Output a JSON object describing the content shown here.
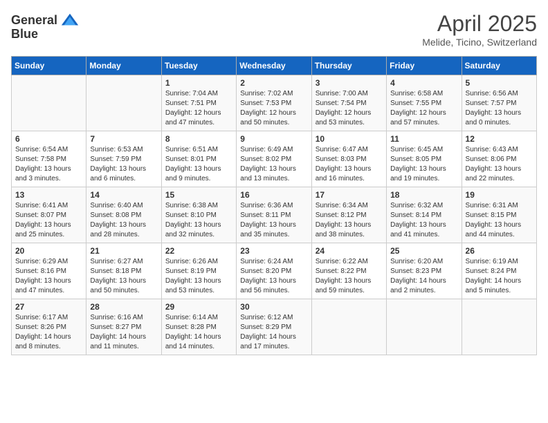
{
  "header": {
    "logo_general": "General",
    "logo_blue": "Blue",
    "month": "April 2025",
    "location": "Melide, Ticino, Switzerland"
  },
  "weekdays": [
    "Sunday",
    "Monday",
    "Tuesday",
    "Wednesday",
    "Thursday",
    "Friday",
    "Saturday"
  ],
  "weeks": [
    [
      {
        "day": "",
        "info": ""
      },
      {
        "day": "",
        "info": ""
      },
      {
        "day": "1",
        "info": "Sunrise: 7:04 AM\nSunset: 7:51 PM\nDaylight: 12 hours and 47 minutes."
      },
      {
        "day": "2",
        "info": "Sunrise: 7:02 AM\nSunset: 7:53 PM\nDaylight: 12 hours and 50 minutes."
      },
      {
        "day": "3",
        "info": "Sunrise: 7:00 AM\nSunset: 7:54 PM\nDaylight: 12 hours and 53 minutes."
      },
      {
        "day": "4",
        "info": "Sunrise: 6:58 AM\nSunset: 7:55 PM\nDaylight: 12 hours and 57 minutes."
      },
      {
        "day": "5",
        "info": "Sunrise: 6:56 AM\nSunset: 7:57 PM\nDaylight: 13 hours and 0 minutes."
      }
    ],
    [
      {
        "day": "6",
        "info": "Sunrise: 6:54 AM\nSunset: 7:58 PM\nDaylight: 13 hours and 3 minutes."
      },
      {
        "day": "7",
        "info": "Sunrise: 6:53 AM\nSunset: 7:59 PM\nDaylight: 13 hours and 6 minutes."
      },
      {
        "day": "8",
        "info": "Sunrise: 6:51 AM\nSunset: 8:01 PM\nDaylight: 13 hours and 9 minutes."
      },
      {
        "day": "9",
        "info": "Sunrise: 6:49 AM\nSunset: 8:02 PM\nDaylight: 13 hours and 13 minutes."
      },
      {
        "day": "10",
        "info": "Sunrise: 6:47 AM\nSunset: 8:03 PM\nDaylight: 13 hours and 16 minutes."
      },
      {
        "day": "11",
        "info": "Sunrise: 6:45 AM\nSunset: 8:05 PM\nDaylight: 13 hours and 19 minutes."
      },
      {
        "day": "12",
        "info": "Sunrise: 6:43 AM\nSunset: 8:06 PM\nDaylight: 13 hours and 22 minutes."
      }
    ],
    [
      {
        "day": "13",
        "info": "Sunrise: 6:41 AM\nSunset: 8:07 PM\nDaylight: 13 hours and 25 minutes."
      },
      {
        "day": "14",
        "info": "Sunrise: 6:40 AM\nSunset: 8:08 PM\nDaylight: 13 hours and 28 minutes."
      },
      {
        "day": "15",
        "info": "Sunrise: 6:38 AM\nSunset: 8:10 PM\nDaylight: 13 hours and 32 minutes."
      },
      {
        "day": "16",
        "info": "Sunrise: 6:36 AM\nSunset: 8:11 PM\nDaylight: 13 hours and 35 minutes."
      },
      {
        "day": "17",
        "info": "Sunrise: 6:34 AM\nSunset: 8:12 PM\nDaylight: 13 hours and 38 minutes."
      },
      {
        "day": "18",
        "info": "Sunrise: 6:32 AM\nSunset: 8:14 PM\nDaylight: 13 hours and 41 minutes."
      },
      {
        "day": "19",
        "info": "Sunrise: 6:31 AM\nSunset: 8:15 PM\nDaylight: 13 hours and 44 minutes."
      }
    ],
    [
      {
        "day": "20",
        "info": "Sunrise: 6:29 AM\nSunset: 8:16 PM\nDaylight: 13 hours and 47 minutes."
      },
      {
        "day": "21",
        "info": "Sunrise: 6:27 AM\nSunset: 8:18 PM\nDaylight: 13 hours and 50 minutes."
      },
      {
        "day": "22",
        "info": "Sunrise: 6:26 AM\nSunset: 8:19 PM\nDaylight: 13 hours and 53 minutes."
      },
      {
        "day": "23",
        "info": "Sunrise: 6:24 AM\nSunset: 8:20 PM\nDaylight: 13 hours and 56 minutes."
      },
      {
        "day": "24",
        "info": "Sunrise: 6:22 AM\nSunset: 8:22 PM\nDaylight: 13 hours and 59 minutes."
      },
      {
        "day": "25",
        "info": "Sunrise: 6:20 AM\nSunset: 8:23 PM\nDaylight: 14 hours and 2 minutes."
      },
      {
        "day": "26",
        "info": "Sunrise: 6:19 AM\nSunset: 8:24 PM\nDaylight: 14 hours and 5 minutes."
      }
    ],
    [
      {
        "day": "27",
        "info": "Sunrise: 6:17 AM\nSunset: 8:26 PM\nDaylight: 14 hours and 8 minutes."
      },
      {
        "day": "28",
        "info": "Sunrise: 6:16 AM\nSunset: 8:27 PM\nDaylight: 14 hours and 11 minutes."
      },
      {
        "day": "29",
        "info": "Sunrise: 6:14 AM\nSunset: 8:28 PM\nDaylight: 14 hours and 14 minutes."
      },
      {
        "day": "30",
        "info": "Sunrise: 6:12 AM\nSunset: 8:29 PM\nDaylight: 14 hours and 17 minutes."
      },
      {
        "day": "",
        "info": ""
      },
      {
        "day": "",
        "info": ""
      },
      {
        "day": "",
        "info": ""
      }
    ]
  ]
}
